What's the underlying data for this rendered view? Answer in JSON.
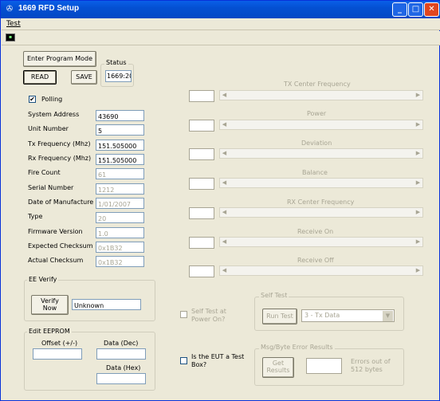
{
  "window": {
    "title": "1669 RFD Setup",
    "minimize": "_",
    "maximize": "□",
    "close": "✕"
  },
  "menu": {
    "test": "Test"
  },
  "buttons": {
    "enter_program_mode": "Enter Program Mode",
    "read": "READ",
    "save": "SAVE"
  },
  "status": {
    "label": "Status",
    "value": "1669:20"
  },
  "polling": {
    "label": "Polling",
    "checked": true,
    "mark": "✔"
  },
  "fields": [
    {
      "label": "System Address",
      "value": "43690",
      "readonly": false
    },
    {
      "label": "Unit Number",
      "value": "5",
      "readonly": false
    },
    {
      "label": "Tx Frequency (Mhz)",
      "value": "151.505000",
      "readonly": false
    },
    {
      "label": "Rx Frequency (Mhz)",
      "value": "151.505000",
      "readonly": false
    },
    {
      "label": "Fire Count",
      "value": "61",
      "readonly": true
    },
    {
      "label": "Serial Number",
      "value": "1212",
      "readonly": true
    },
    {
      "label": "Date of Manufacture",
      "value": "1/01/2007",
      "readonly": true
    },
    {
      "label": "Type",
      "value": "20",
      "readonly": true
    },
    {
      "label": "Firmware Version",
      "value": "1.0",
      "readonly": true
    },
    {
      "label": "Expected Checksum",
      "value": "0x1B32",
      "readonly": true
    },
    {
      "label": "Actual Checksum",
      "value": "0x1B32",
      "readonly": true
    }
  ],
  "ee_verify": {
    "title": "EE Verify",
    "button": "Verify Now",
    "result": "Unknown"
  },
  "edit_eeprom": {
    "title": "Edit EEPROM",
    "offset_label": "Offset (+/-)",
    "data_dec_label": "Data (Dec)",
    "data_hex_label": "Data (Hex)"
  },
  "sliders": [
    {
      "label": "TX Center Frequency"
    },
    {
      "label": "Power"
    },
    {
      "label": "Deviation"
    },
    {
      "label": "Balance"
    },
    {
      "label": "RX Center Frequency"
    },
    {
      "label": "Receive On"
    },
    {
      "label": "Receive Off"
    }
  ],
  "scroll_arrows": {
    "left": "◀",
    "right": "▶"
  },
  "self_test_power": {
    "label": "Self Test at Power On?"
  },
  "self_test": {
    "title": "Self Test",
    "button": "Run Test",
    "selected": "3 - Tx Data",
    "arrow": "▼"
  },
  "eut_test_box": {
    "label": "Is the EUT a Test Box?"
  },
  "msg_errors": {
    "title": "Msg/Byte Error Results",
    "button": "Get Results",
    "errors_text": "Errors out of 512 bytes"
  }
}
